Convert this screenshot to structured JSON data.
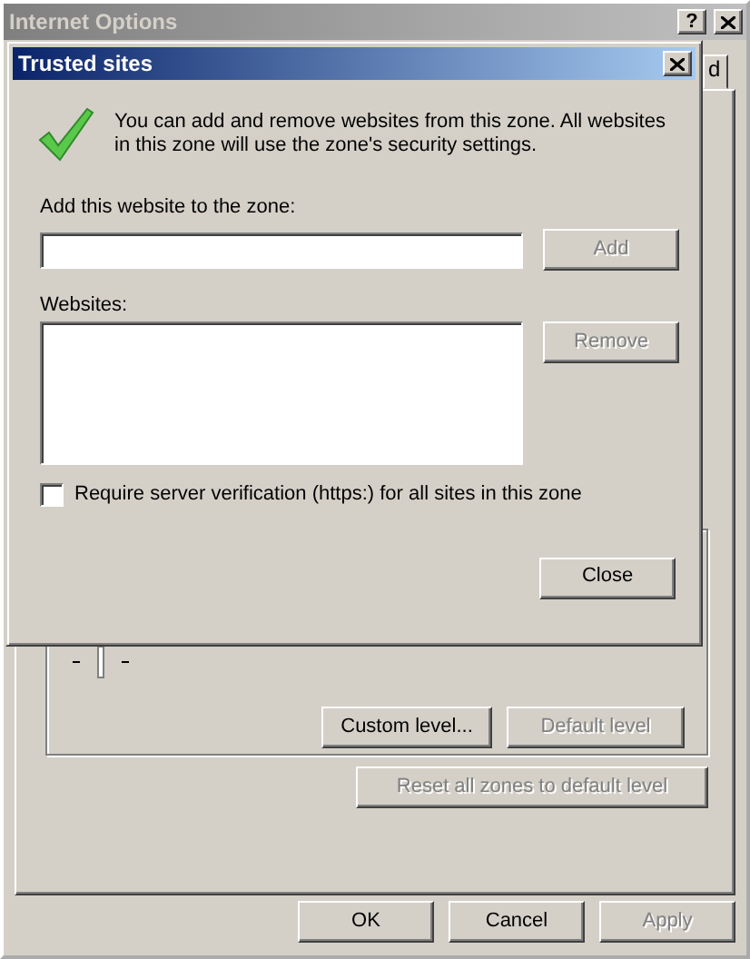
{
  "parent_window": {
    "title": "Internet Options",
    "active": false,
    "help_button": "?",
    "tab_fragment": "d",
    "zone_buttons": [
      {
        "label": "Custom level...",
        "disabled": false
      },
      {
        "label": "Default level",
        "disabled": true
      }
    ],
    "reset_button": {
      "label": "Reset all zones to default level",
      "disabled": true
    },
    "footer_buttons": [
      {
        "label": "OK",
        "disabled": false
      },
      {
        "label": "Cancel",
        "disabled": false
      },
      {
        "label": "Apply",
        "disabled": true
      }
    ]
  },
  "dialog": {
    "title": "Trusted sites",
    "active": true,
    "message": "You can add and remove websites from this zone. All websites in this zone will use the zone's security settings.",
    "add_label": "Add this website to the zone:",
    "add_button": {
      "label": "Add",
      "disabled": true
    },
    "websites_label": "Websites:",
    "remove_button": {
      "label": "Remove",
      "disabled": true
    },
    "require_https": {
      "label": "Require server verification (https:) for all sites in this zone",
      "checked": false
    },
    "close_button": {
      "label": "Close",
      "disabled": false
    }
  }
}
